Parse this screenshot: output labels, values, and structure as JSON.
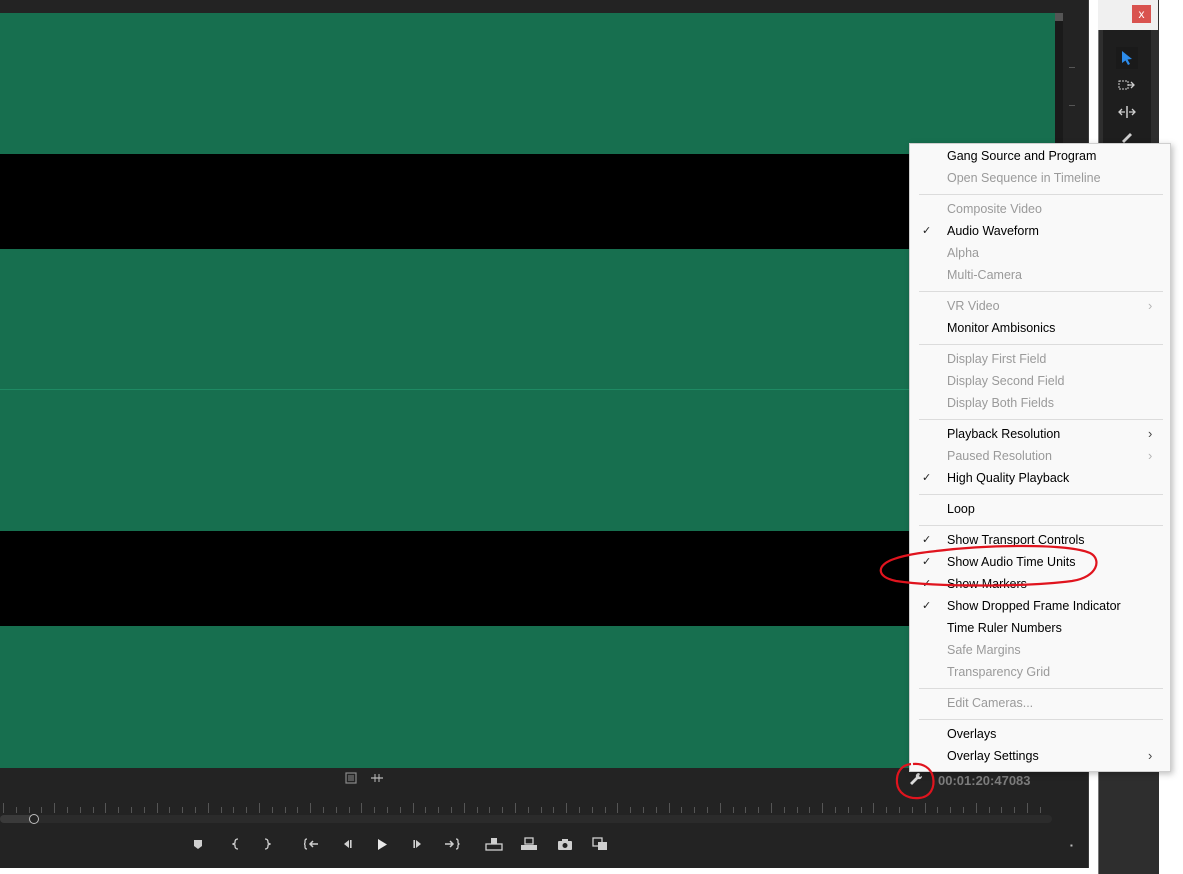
{
  "monitor": {
    "timecode": "00:01:20:47083"
  },
  "window": {
    "close_label": "x"
  },
  "menu": {
    "items": [
      {
        "label": "Gang Source and Program",
        "enabled": true,
        "checked": false,
        "submenu": false
      },
      {
        "label": "Open Sequence in Timeline",
        "enabled": false,
        "checked": false,
        "submenu": false
      },
      {
        "label": "Composite Video",
        "enabled": false,
        "checked": false,
        "submenu": false
      },
      {
        "label": "Audio Waveform",
        "enabled": true,
        "checked": true,
        "submenu": false
      },
      {
        "label": "Alpha",
        "enabled": false,
        "checked": false,
        "submenu": false
      },
      {
        "label": "Multi-Camera",
        "enabled": false,
        "checked": false,
        "submenu": false
      },
      {
        "label": "VR Video",
        "enabled": false,
        "checked": false,
        "submenu": true
      },
      {
        "label": "Monitor Ambisonics",
        "enabled": true,
        "checked": false,
        "submenu": false
      },
      {
        "label": "Display First Field",
        "enabled": false,
        "checked": false,
        "submenu": false
      },
      {
        "label": "Display Second Field",
        "enabled": false,
        "checked": false,
        "submenu": false
      },
      {
        "label": "Display Both Fields",
        "enabled": false,
        "checked": false,
        "submenu": false
      },
      {
        "label": "Playback Resolution",
        "enabled": true,
        "checked": false,
        "submenu": true
      },
      {
        "label": "Paused Resolution",
        "enabled": false,
        "checked": false,
        "submenu": true
      },
      {
        "label": "High Quality Playback",
        "enabled": true,
        "checked": true,
        "submenu": false
      },
      {
        "label": "Loop",
        "enabled": true,
        "checked": false,
        "submenu": false
      },
      {
        "label": "Show Transport Controls",
        "enabled": true,
        "checked": true,
        "submenu": false
      },
      {
        "label": "Show Audio Time Units",
        "enabled": true,
        "checked": true,
        "submenu": false
      },
      {
        "label": "Show Markers",
        "enabled": true,
        "checked": true,
        "submenu": false
      },
      {
        "label": "Show Dropped Frame Indicator",
        "enabled": true,
        "checked": true,
        "submenu": false
      },
      {
        "label": "Time Ruler Numbers",
        "enabled": true,
        "checked": false,
        "submenu": false
      },
      {
        "label": "Safe Margins",
        "enabled": false,
        "checked": false,
        "submenu": false
      },
      {
        "label": "Transparency Grid",
        "enabled": false,
        "checked": false,
        "submenu": false
      },
      {
        "label": "Edit Cameras...",
        "enabled": false,
        "checked": false,
        "submenu": false
      },
      {
        "label": "Overlays",
        "enabled": true,
        "checked": false,
        "submenu": false
      },
      {
        "label": "Overlay Settings",
        "enabled": true,
        "checked": false,
        "submenu": true
      }
    ],
    "check_glyph": "✓",
    "arrow_glyph": "›"
  },
  "colors": {
    "waveform": "#176f4f",
    "annotation": "#e0141e"
  }
}
